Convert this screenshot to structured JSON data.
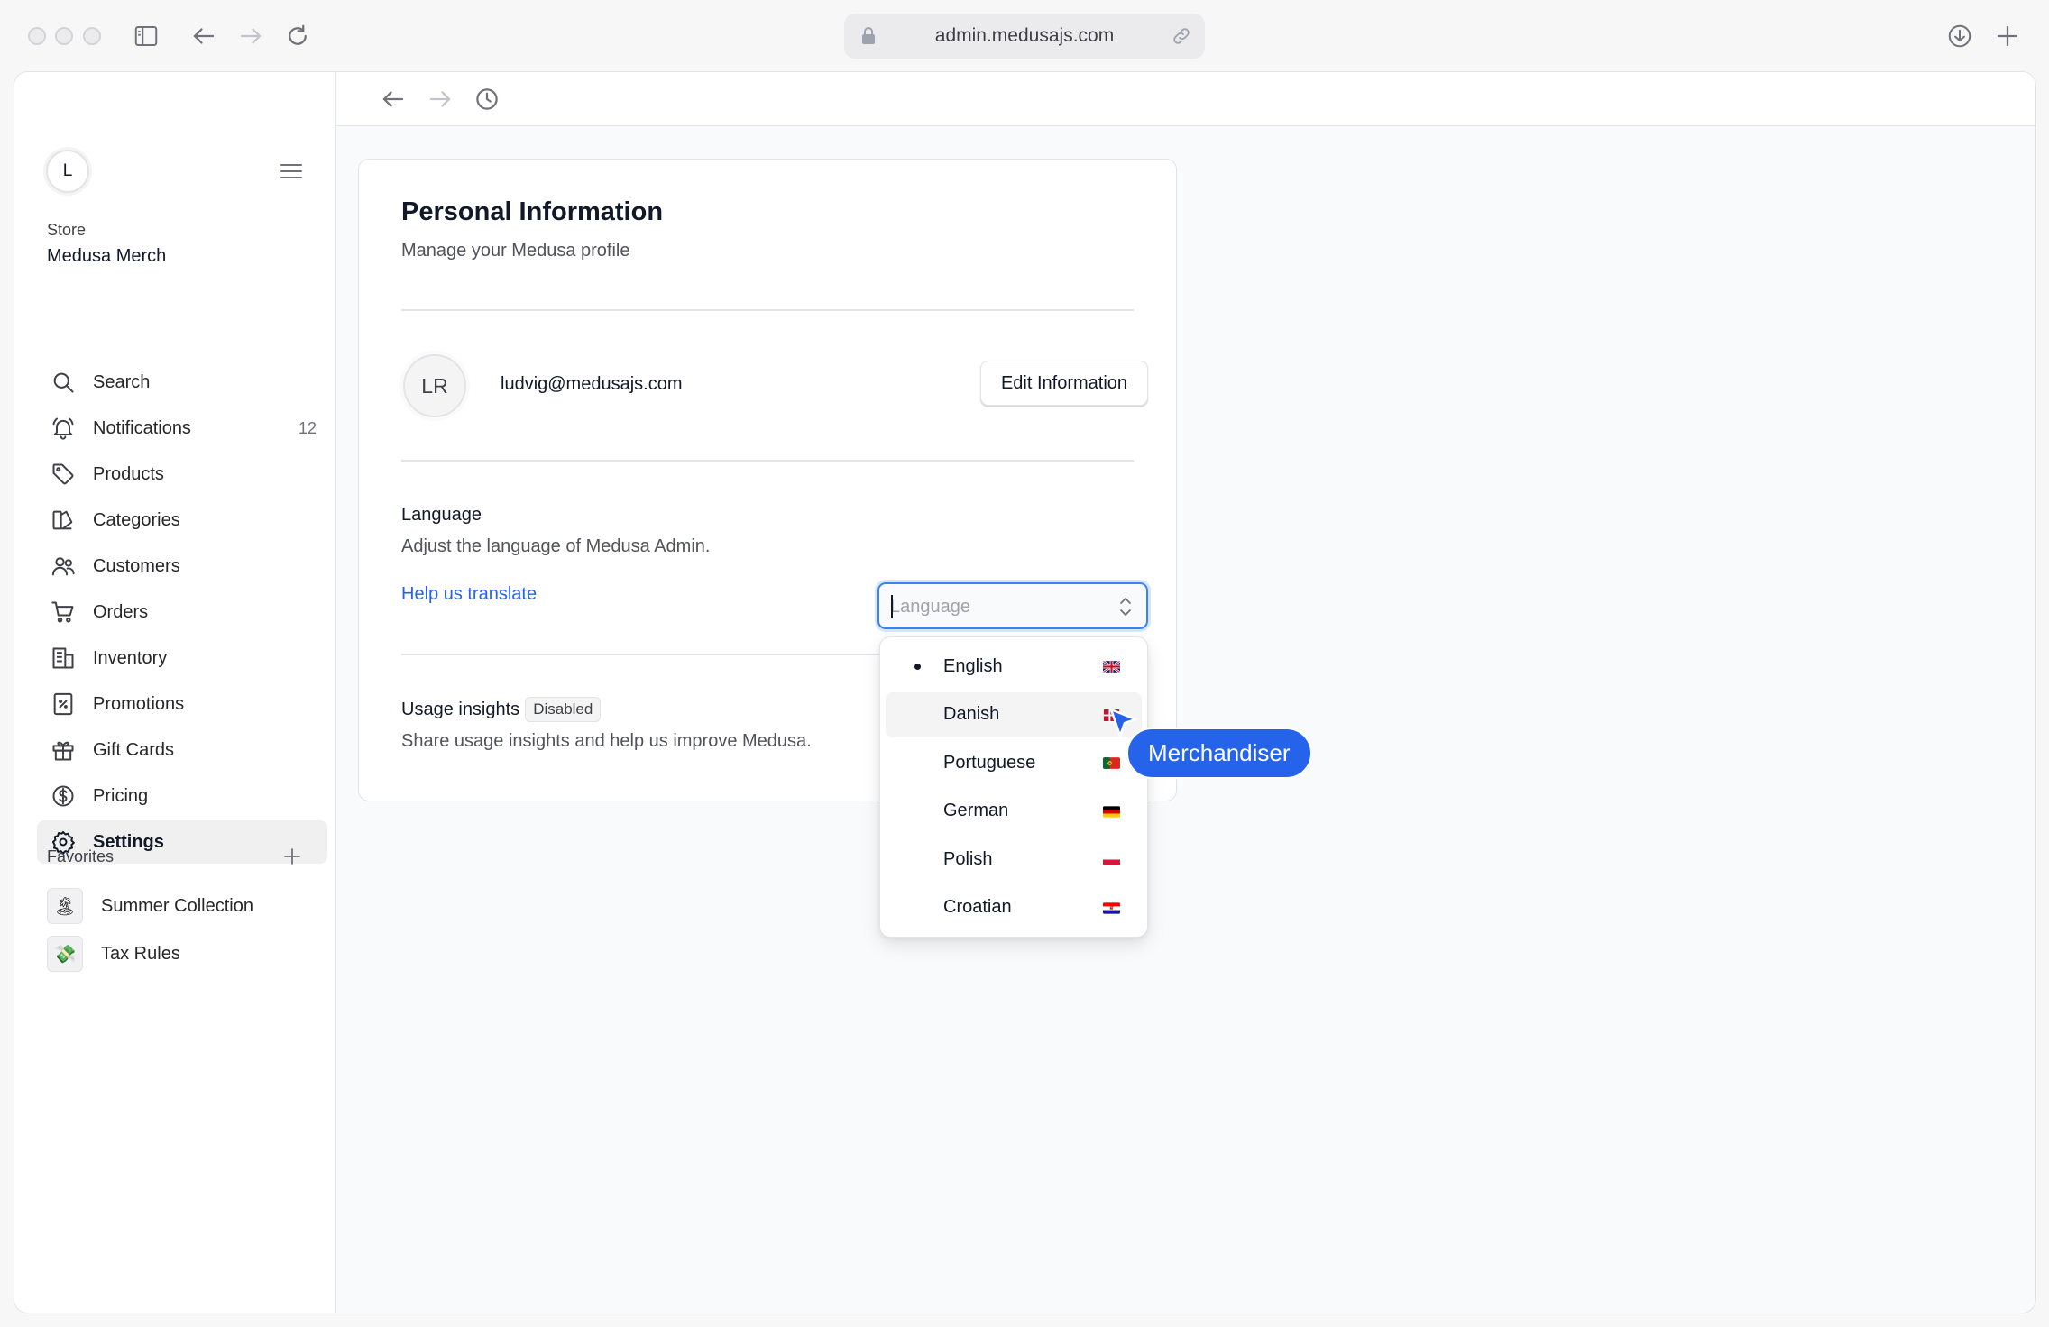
{
  "browser": {
    "url": "admin.medusajs.com"
  },
  "sidebar": {
    "avatar_initial": "L",
    "store_label": "Store",
    "store_name": "Medusa Merch",
    "items": [
      {
        "label": "Search",
        "icon": "search-icon"
      },
      {
        "label": "Notifications",
        "icon": "bell-icon",
        "count": "12"
      },
      {
        "label": "Products",
        "icon": "tag-icon"
      },
      {
        "label": "Categories",
        "icon": "categories-icon"
      },
      {
        "label": "Customers",
        "icon": "users-icon"
      },
      {
        "label": "Orders",
        "icon": "cart-icon"
      },
      {
        "label": "Inventory",
        "icon": "building-icon"
      },
      {
        "label": "Promotions",
        "icon": "receipt-percent-icon"
      },
      {
        "label": "Gift Cards",
        "icon": "gift-icon"
      },
      {
        "label": "Pricing",
        "icon": "dollar-circle-icon"
      },
      {
        "label": "Settings",
        "icon": "gear-icon",
        "active": true
      }
    ],
    "favorites_label": "Favorites",
    "favorites": [
      {
        "label": "Summer Collection",
        "emoji": "🏝"
      },
      {
        "label": "Tax Rules",
        "emoji": "💸"
      }
    ]
  },
  "profile": {
    "title": "Personal Information",
    "subtitle": "Manage your Medusa profile",
    "initials": "LR",
    "email": "ludvig@medusajs.com",
    "edit_button": "Edit Information",
    "language_title": "Language",
    "language_subtitle": "Adjust the language of Medusa Admin.",
    "help_link": "Help us translate",
    "usage_title": "Usage insights",
    "usage_badge": "Disabled",
    "usage_subtitle": "Share usage insights and help us improve Medusa."
  },
  "language_select": {
    "placeholder": "Language",
    "value": "",
    "options": [
      {
        "label": "English",
        "flag": "gb",
        "selected": true
      },
      {
        "label": "Danish",
        "flag": "dk",
        "hover": true
      },
      {
        "label": "Portuguese",
        "flag": "pt"
      },
      {
        "label": "German",
        "flag": "de"
      },
      {
        "label": "Polish",
        "flag": "pl"
      },
      {
        "label": "Croatian",
        "flag": "hr"
      }
    ]
  },
  "cursor_label": "Merchandiser",
  "colors": {
    "accent": "#2563eb",
    "focus_ring": "#3b82f6",
    "active_nav_bg": "#f0f0f1"
  }
}
